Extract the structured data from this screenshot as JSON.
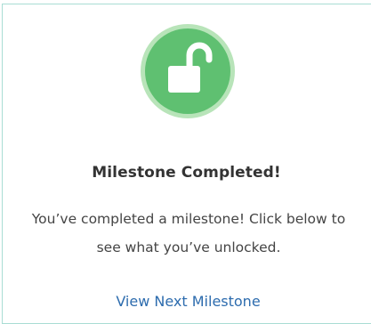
{
  "milestone": {
    "icon": "unlocked-padlock-icon",
    "badge_color": "#5fc071",
    "ring_color": "#b8e4b9",
    "title": "Milestone Completed!",
    "message": "You’ve completed a milestone! Click below to see what you’ve unlocked.",
    "link_label": "View Next Milestone",
    "link_color": "#2d6cae"
  }
}
